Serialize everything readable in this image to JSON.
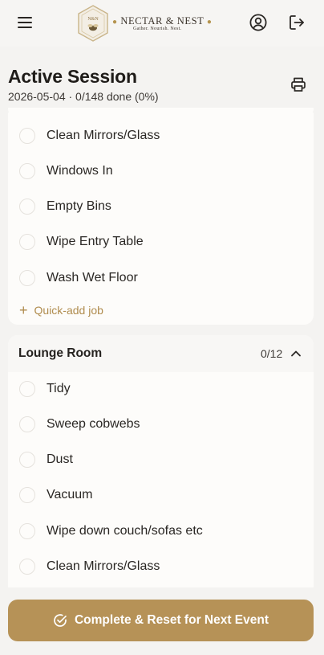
{
  "header": {
    "brand_name": "NECTAR & NEST",
    "brand_tagline": "Gather. Nourish. Nest.",
    "icons": {
      "menu": "menu-icon",
      "account": "user-circle-icon",
      "logout": "logout-icon"
    }
  },
  "session": {
    "title": "Active Session",
    "subtitle": "2026-05-04 · 0/148 done (0%)",
    "print_icon": "printer-icon"
  },
  "sections": [
    {
      "title": "",
      "tasks": [
        {
          "label": "Clean Mirrors/Glass",
          "done": false
        },
        {
          "label": "Windows In",
          "done": false
        },
        {
          "label": "Empty Bins",
          "done": false
        },
        {
          "label": "Wipe Entry Table",
          "done": false
        },
        {
          "label": "Wash Wet Floor",
          "done": false
        }
      ],
      "quick_add_label": "Quick-add job"
    },
    {
      "title": "Lounge Room",
      "count": "0/12",
      "expanded": true,
      "tasks": [
        {
          "label": "Tidy",
          "done": false
        },
        {
          "label": "Sweep cobwebs",
          "done": false
        },
        {
          "label": "Dust",
          "done": false
        },
        {
          "label": "Vacuum",
          "done": false
        },
        {
          "label": "Wipe down couch/sofas etc",
          "done": false
        },
        {
          "label": "Clean Mirrors/Glass",
          "done": false
        }
      ]
    }
  ],
  "footer": {
    "complete_button_label": "Complete & Reset for Next Event",
    "complete_icon": "check-circle-icon"
  },
  "colors": {
    "accent": "#b69257",
    "accent_text": "#b08c4e",
    "background": "#f4f3f1",
    "card": "#fdfcfa"
  }
}
